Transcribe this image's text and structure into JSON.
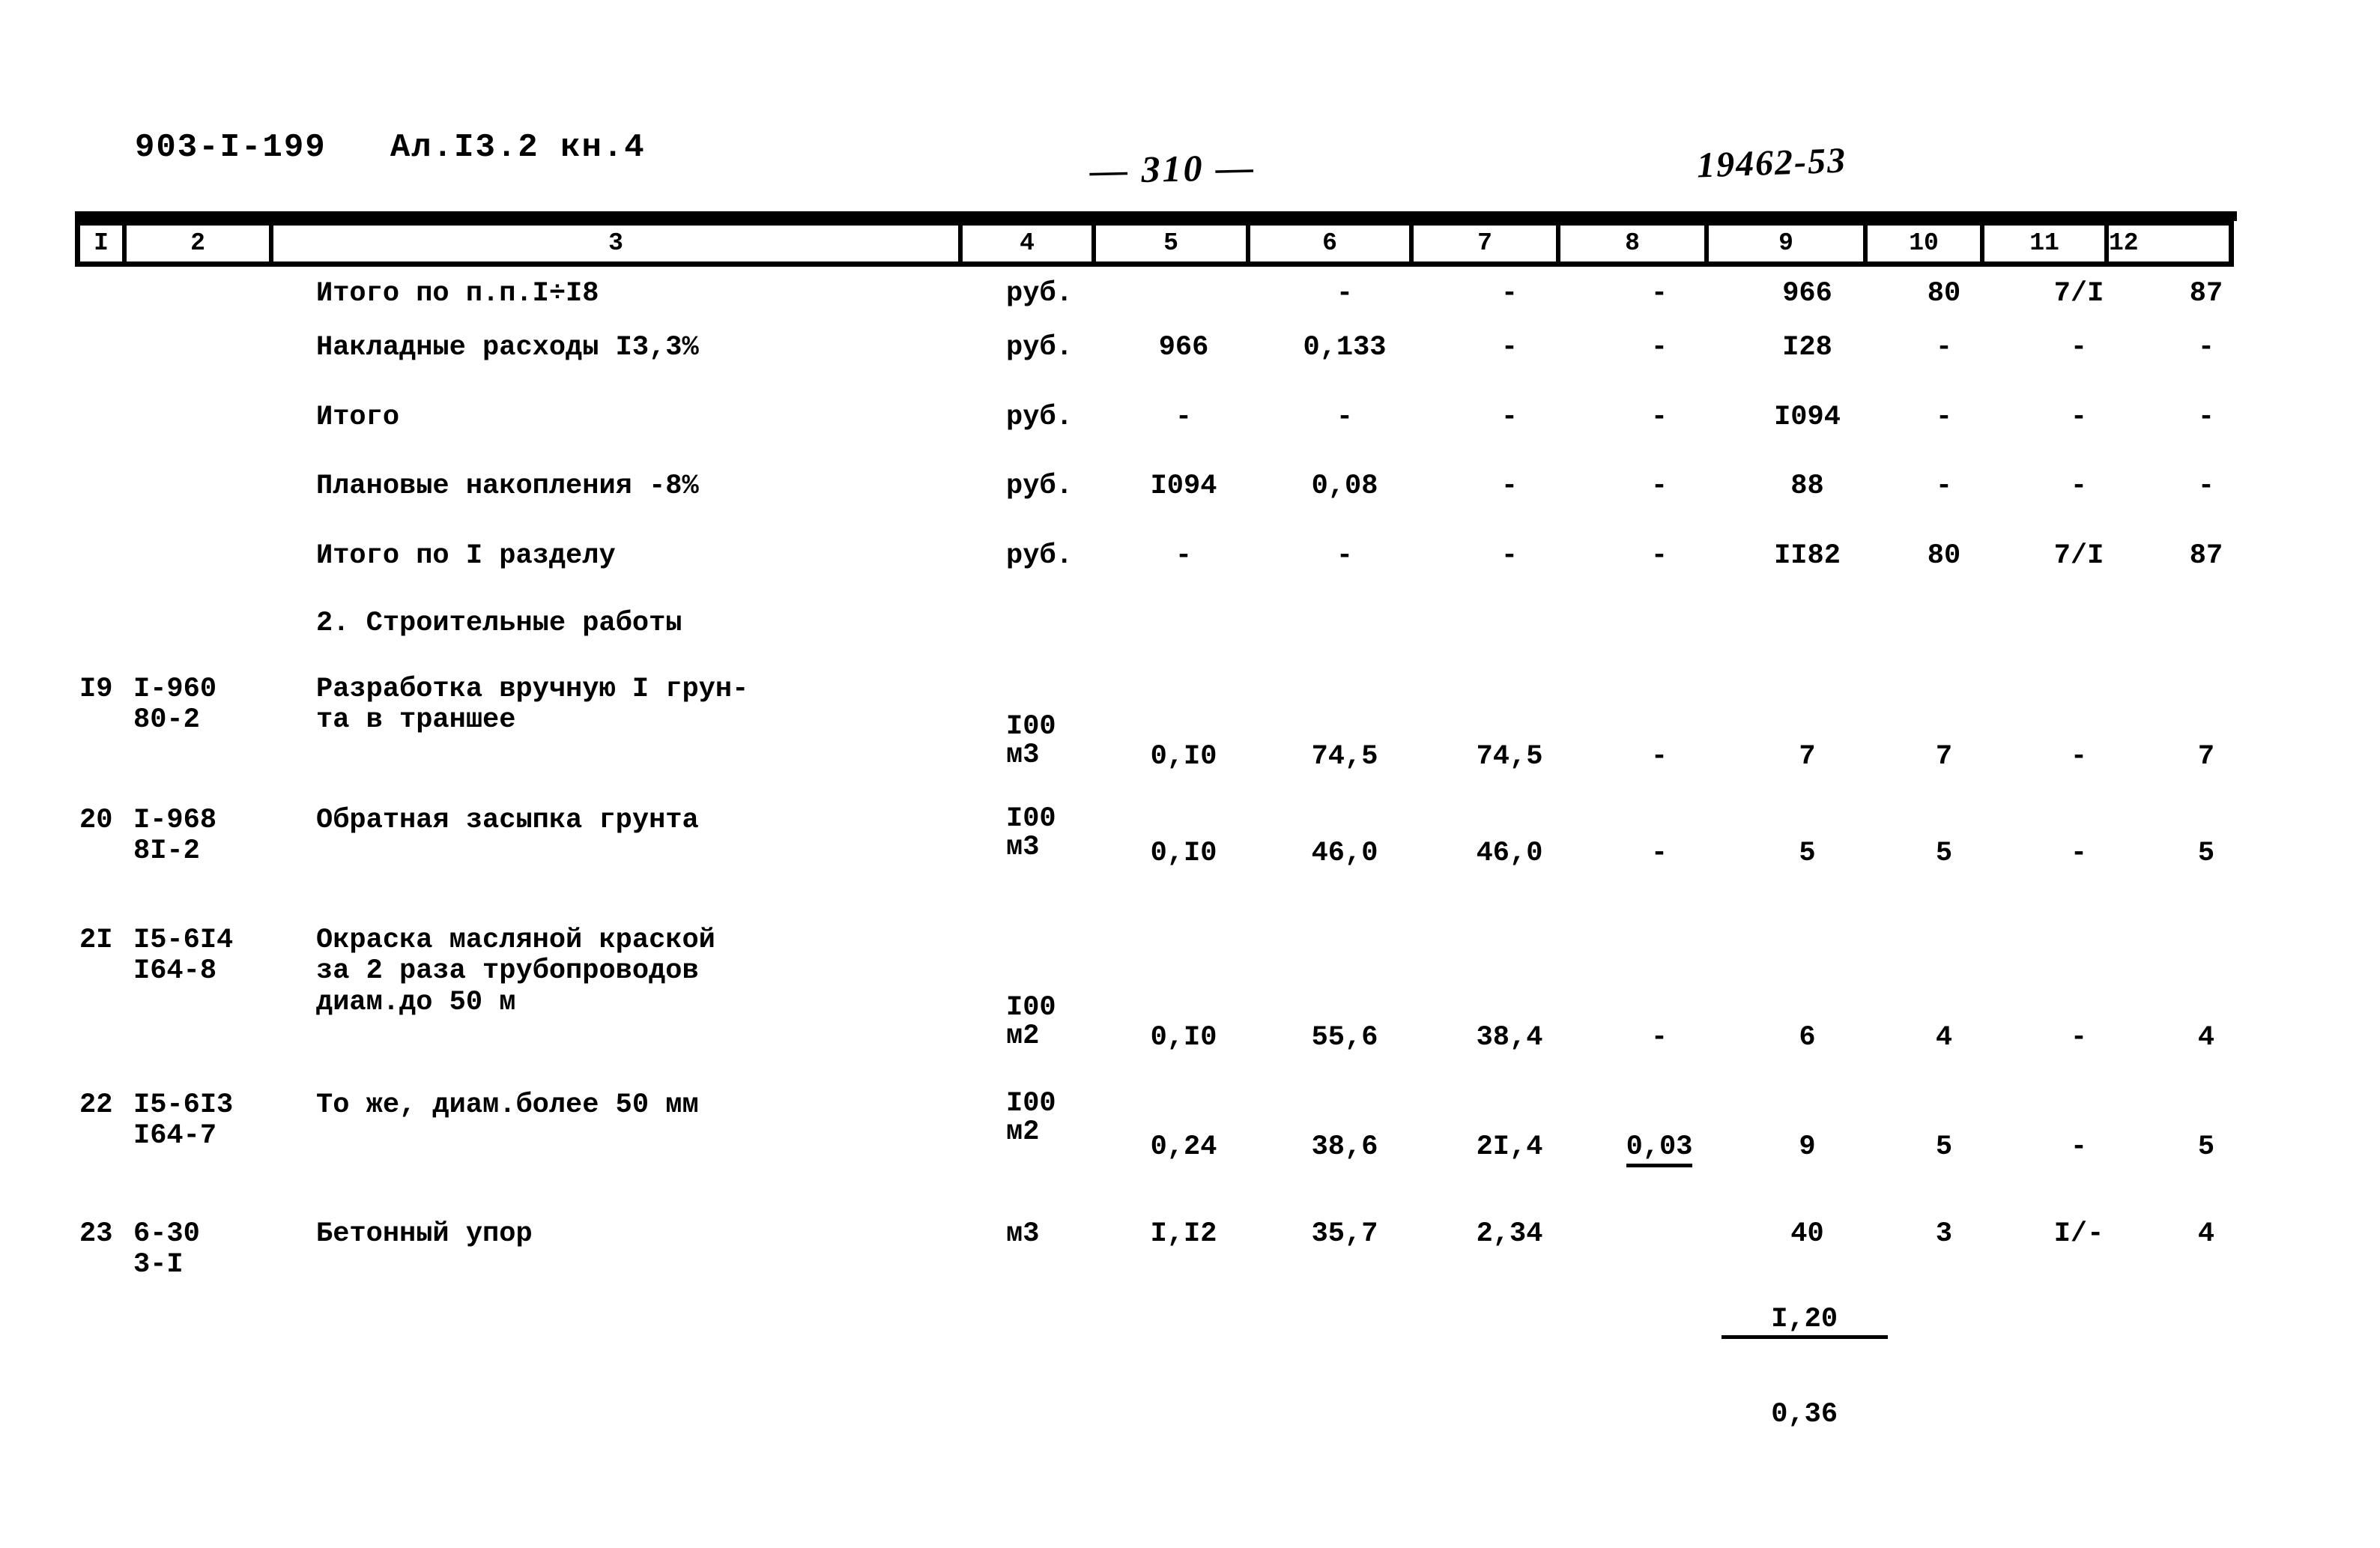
{
  "header": {
    "doc_code": "903-I-199   Ал.I3.2 кн.4",
    "page_number": "— 310 —",
    "archive_number": "19462-53"
  },
  "table": {
    "column_numbers": [
      "I",
      "2",
      "3",
      "4",
      "5",
      "6",
      "7",
      "8",
      "9",
      "10",
      "11",
      "12"
    ],
    "section_heading": "2. Строительные работы",
    "rows": [
      {
        "n": "",
        "code": "",
        "name": "Итого по п.п.I÷I8",
        "unit": "руб.",
        "c5": "",
        "c6": "-",
        "c7": "-",
        "c8": "-",
        "c9": "966",
        "c10": "80",
        "c11": "7/I",
        "c12": "87"
      },
      {
        "n": "",
        "code": "",
        "name": "Накладные расходы I3,3%",
        "unit": "руб.",
        "c5": "966",
        "c6": "0,133",
        "c7": "-",
        "c8": "-",
        "c9": "I28",
        "c10": "-",
        "c11": "-",
        "c12": "-"
      },
      {
        "n": "",
        "code": "",
        "name": "Итого",
        "unit": "руб.",
        "c5": "-",
        "c6": "-",
        "c7": "-",
        "c8": "-",
        "c9": "I094",
        "c10": "-",
        "c11": "-",
        "c12": "-"
      },
      {
        "n": "",
        "code": "",
        "name": "Плановые накопления -8%",
        "unit": "руб.",
        "c5": "I094",
        "c6": "0,08",
        "c7": "-",
        "c8": "-",
        "c9": "88",
        "c10": "-",
        "c11": "-",
        "c12": "-"
      },
      {
        "n": "",
        "code": "",
        "name": "Итого по I разделу",
        "unit": "руб.",
        "c5": "-",
        "c6": "-",
        "c7": "-",
        "c8": "-",
        "c9": "II82",
        "c10": "80",
        "c11": "7/I",
        "c12": "87"
      },
      {
        "n": "I9",
        "code": "I-960\n80-2",
        "name": "Разработка вручную I грун-\nта в траншее",
        "unit": "I00\nм3",
        "c5": "0,I0",
        "c6": "74,5",
        "c7": "74,5",
        "c8": "-",
        "c9": "7",
        "c10": "7",
        "c11": "-",
        "c12": "7"
      },
      {
        "n": "20",
        "code": "I-968\n8I-2",
        "name": "Обратная засыпка грунта",
        "unit": "I00\nм3",
        "c5": "0,I0",
        "c6": "46,0",
        "c7": "46,0",
        "c8": "-",
        "c9": "5",
        "c10": "5",
        "c11": "-",
        "c12": "5"
      },
      {
        "n": "2I",
        "code": "I5-6I4\nI64-8",
        "name": "Окраска масляной краской\nза 2 раза трубопроводов\nдиам.до 50 м",
        "unit": "I00\nм2",
        "c5": "0,I0",
        "c6": "55,6",
        "c7": "38,4",
        "c8": "-",
        "c9": "6",
        "c10": "4",
        "c11": "-",
        "c12": "4"
      },
      {
        "n": "22",
        "code": "I5-6I3\nI64-7",
        "name": "То же, диам.более 50 мм",
        "unit": "I00\nм2",
        "c5": "0,24",
        "c6": "38,6",
        "c7": "2I,4",
        "c8": "0,03",
        "c8_underlined": true,
        "c9": "9",
        "c10": "5",
        "c11": "-",
        "c12": "5"
      },
      {
        "n": "23",
        "code": "6-30\n3-I",
        "name": "Бетонный упор",
        "unit": "м3",
        "c5": "I,I2",
        "c6": "35,7",
        "c7": "2,34",
        "c8_fraction": {
          "numerator": "I,20",
          "denominator": "0,36"
        },
        "c9": "40",
        "c10": "3",
        "c11": "I/-",
        "c12": "4"
      }
    ]
  }
}
